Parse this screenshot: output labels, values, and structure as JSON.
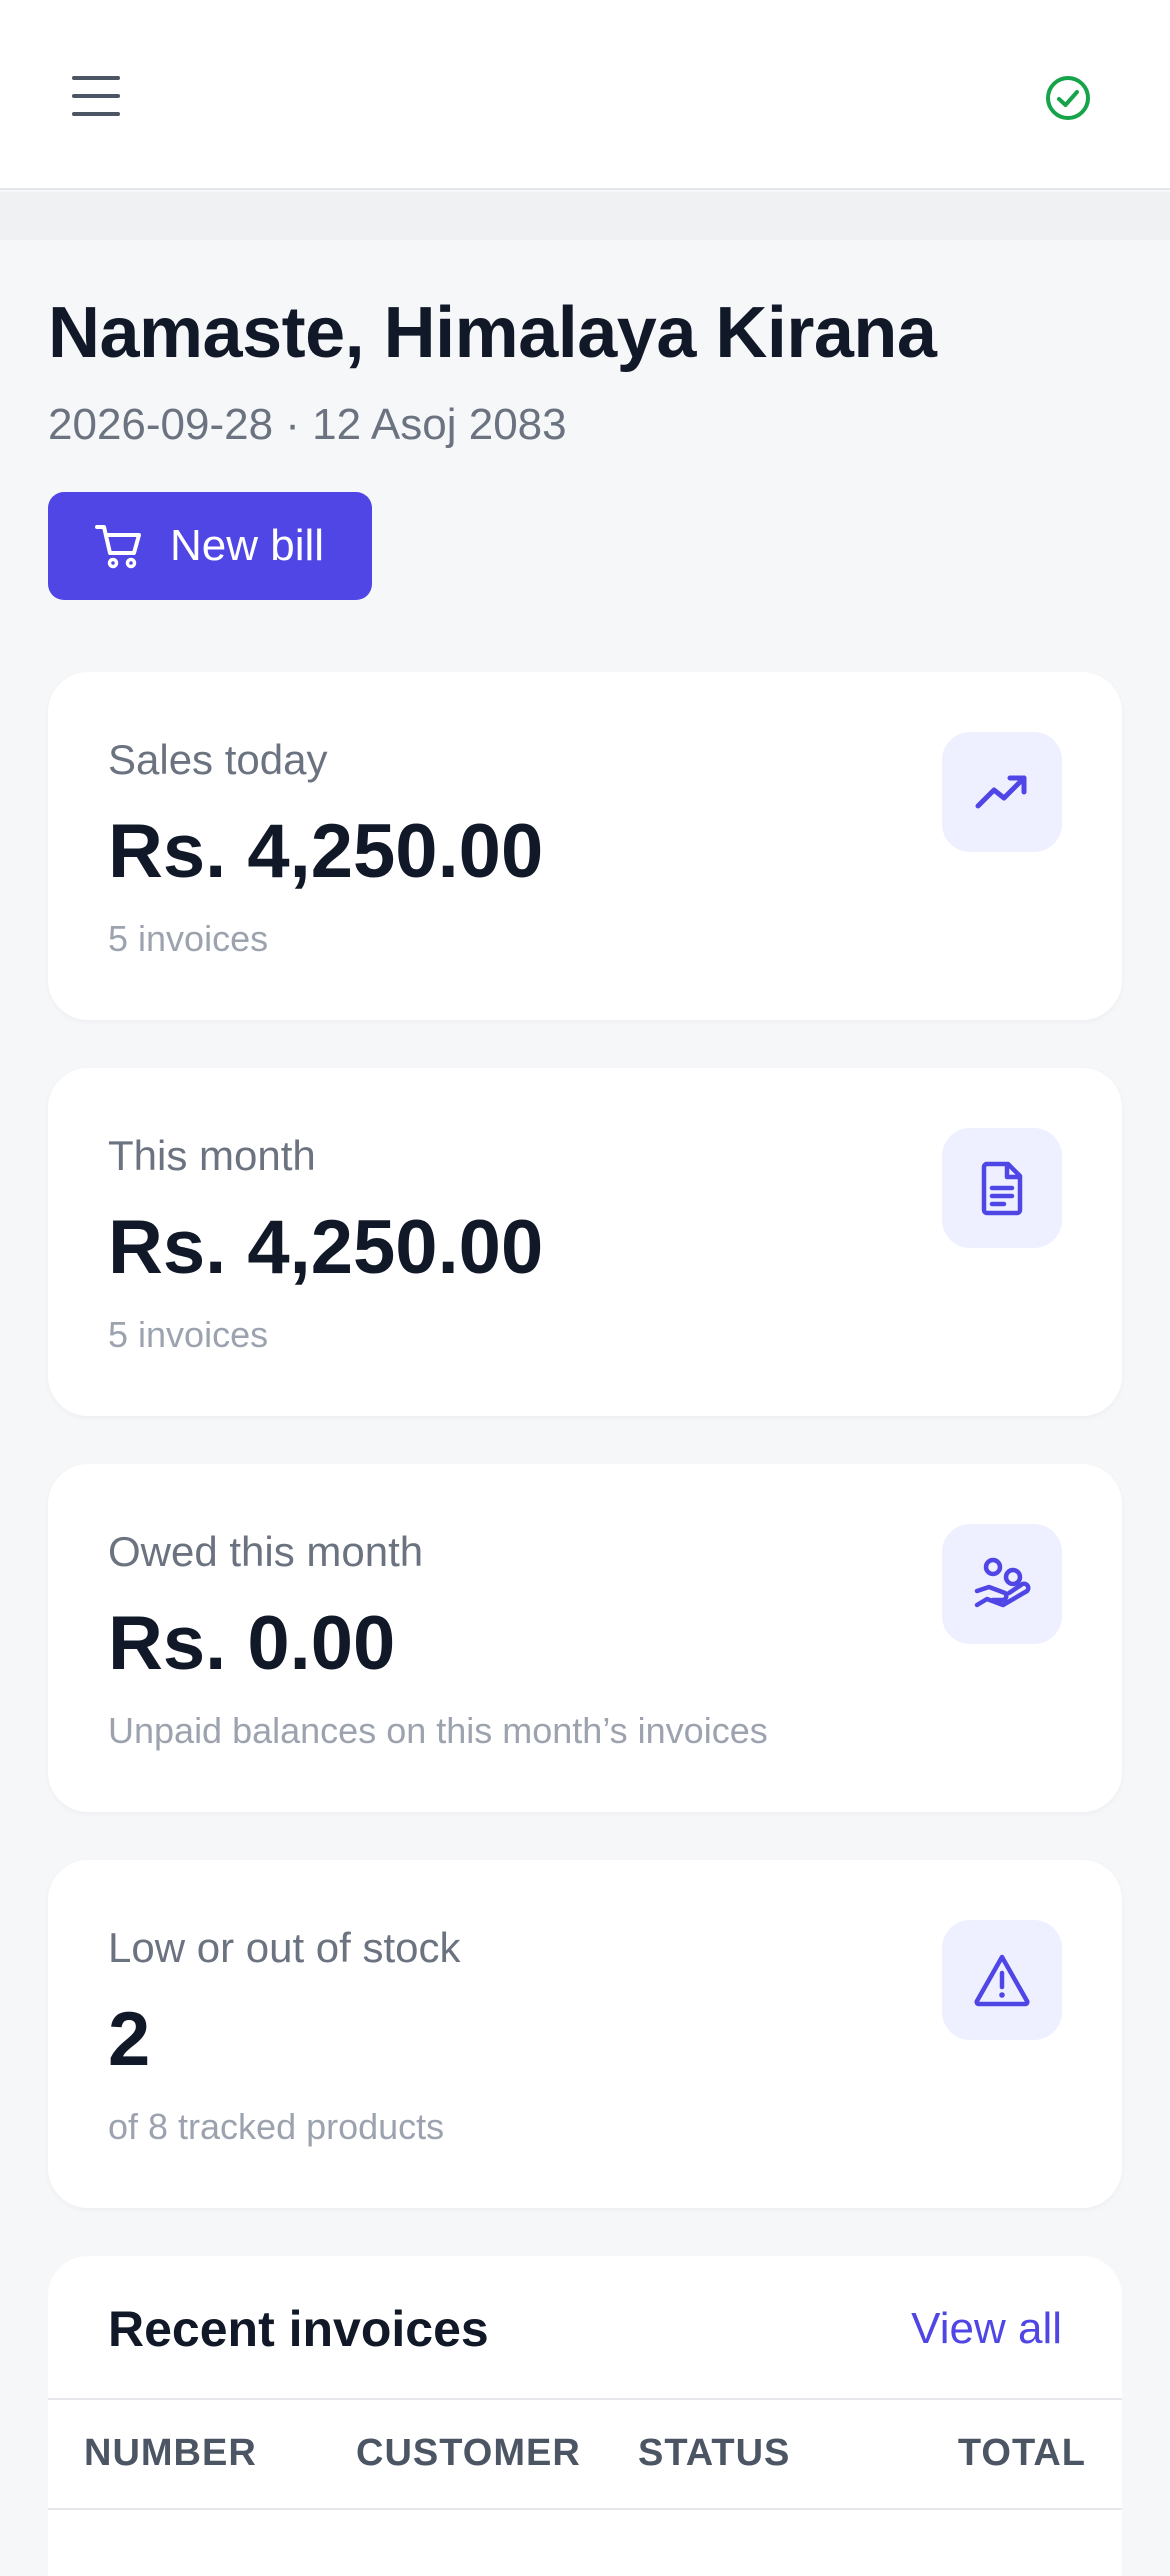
{
  "header": {
    "menu_icon": "hamburger-menu-icon",
    "status_icon": "check-circle-icon",
    "status_color": "#16a34a"
  },
  "greeting": "Namaste, Himalaya Kirana",
  "date_line": "2026-09-28 · 12 Asoj 2083",
  "new_bill": {
    "label": "New bill",
    "icon": "cart-icon",
    "color": "#4f46e5"
  },
  "cards": [
    {
      "label": "Sales today",
      "value": "Rs. 4,250.00",
      "sub": "5 invoices",
      "icon": "trending-up-icon"
    },
    {
      "label": "This month",
      "value": "Rs. 4,250.00",
      "sub": "5 invoices",
      "icon": "document-icon"
    },
    {
      "label": "Owed this month",
      "value": "Rs. 0.00",
      "sub": "Unpaid balances on this month’s invoices",
      "icon": "hand-coins-icon"
    },
    {
      "label": "Low or out of stock",
      "value": "2",
      "sub": "of 8 tracked products",
      "icon": "warning-triangle-icon"
    }
  ],
  "recent_invoices": {
    "title": "Recent invoices",
    "view_all": "View all",
    "columns": [
      "NUMBER",
      "CUSTOMER",
      "STATUS",
      "TOTAL"
    ]
  }
}
